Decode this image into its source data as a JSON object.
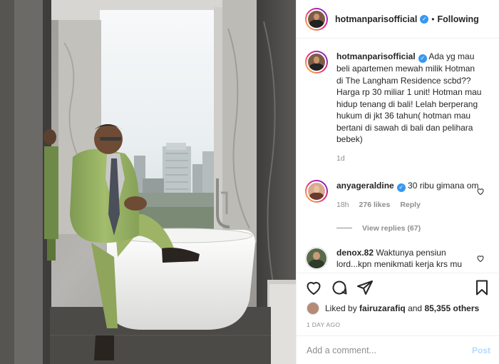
{
  "post": {
    "username": "hotmanparisofficial",
    "follow_state": "Following",
    "separator": "•",
    "verified_mark": "✓",
    "caption": "Ada yg mau beli apartemen mewah milik Hotman di The Langham Residence scbd?? Harga rp 30 miliar 1 unit! Hotman mau hidup tenang di bali! Lelah berperang hukum di jkt 36 tahun( hotman mau bertani di sawah di bali dan pelihara bebek)",
    "caption_age": "1d"
  },
  "comments": [
    {
      "username": "anyageraldine",
      "text": "30 ribu gimana om",
      "age": "18h",
      "likes": "276 likes",
      "reply_label": "Reply",
      "view_replies": "View replies (67)"
    },
    {
      "username": "denox.82",
      "text": "Waktunya pensiun lord...kpn menikmati kerja krs mu"
    }
  ],
  "likes": {
    "prefix": "Liked by",
    "user": "fairuzarafiq",
    "middle": "and",
    "others": "85,355 others"
  },
  "timestamp": "1 DAY AGO",
  "comment_box": {
    "placeholder": "Add a comment...",
    "post_label": "Post"
  },
  "colors": {
    "accent": "#3897f0",
    "post_disabled": "#b3dbff",
    "muted": "#8e8e8e"
  },
  "icons": [
    "heart-icon",
    "comment-icon",
    "share-icon",
    "bookmark-icon",
    "verified-icon"
  ]
}
